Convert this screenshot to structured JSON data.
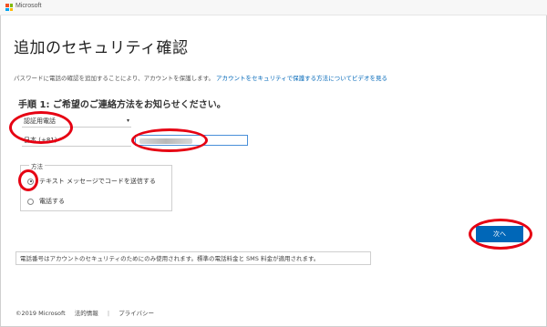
{
  "header": {
    "brand": "Microsoft"
  },
  "main": {
    "title": "追加のセキュリティ確認",
    "description": "パスワードに電話の確認を追加することにより、アカウントを保護します。",
    "video_link": "アカウントをセキュリティで保護する方法についてビデオを見る",
    "step_heading": "手順 1: ご希望のご連絡方法をお知らせください。",
    "contact_method": {
      "selected": "認証用電話",
      "chevron": "▾"
    },
    "country": "日本 (+81)",
    "phone_placeholder": "",
    "method_legend": "方法",
    "options": [
      {
        "label": "テキスト メッセージでコードを送信する",
        "checked": true
      },
      {
        "label": "電話する",
        "checked": false
      }
    ],
    "next_button": "次へ",
    "notice": "電話番号はアカウントのセキュリティのためにのみ使用されます。標準の電話料金と SMS 料金が適用されます。"
  },
  "footer": {
    "copyright": "©2019 Microsoft",
    "legal": "法的情報",
    "separator": "|",
    "privacy": "プライバシー"
  },
  "colors": {
    "accent": "#0067b8",
    "annotation": "#e60012"
  }
}
